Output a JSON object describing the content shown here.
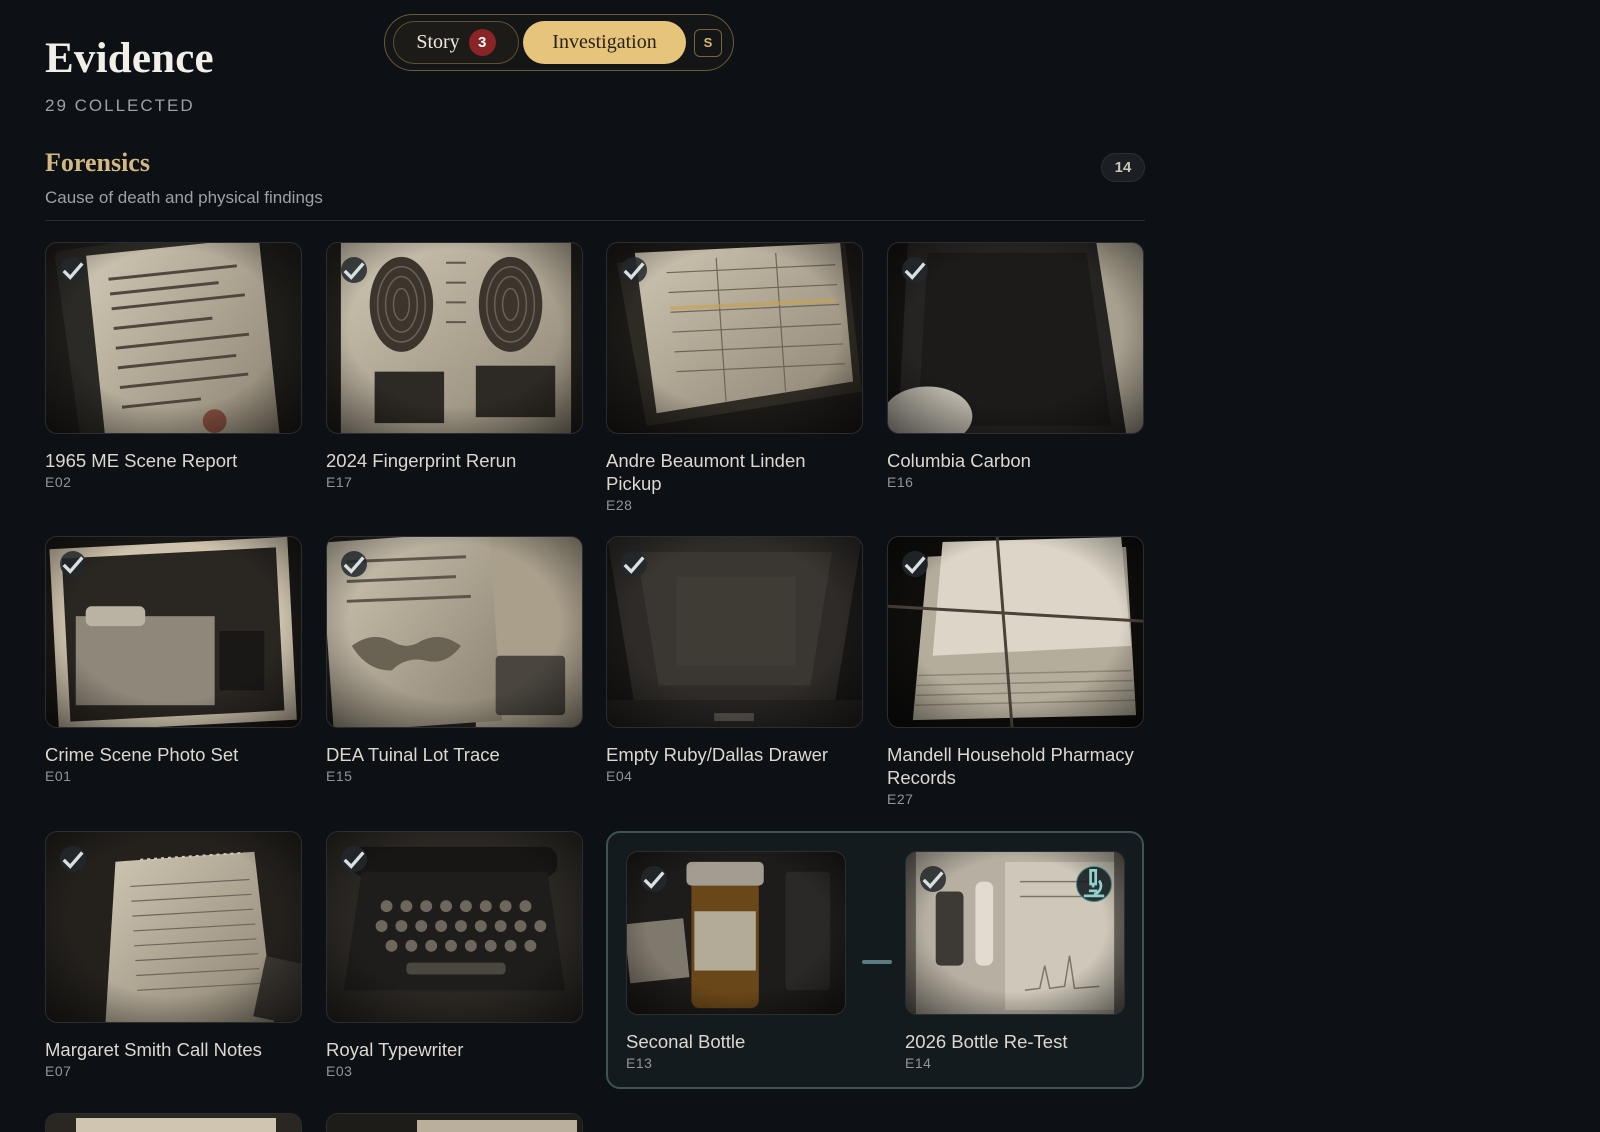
{
  "header": {
    "title": "Evidence",
    "subtitle": "29 COLLECTED"
  },
  "mode_switch": {
    "story_label": "Story",
    "story_badge": "3",
    "investigation_label": "Investigation",
    "shortcut_key": "S",
    "active": "Investigation"
  },
  "section": {
    "title": "Forensics",
    "description": "Cause of death and physical findings",
    "count": "14"
  },
  "cards": [
    {
      "title": "1965 ME Scene Report",
      "code": "E02",
      "collected": true,
      "icon": "report-image"
    },
    {
      "title": "2024 Fingerprint Rerun",
      "code": "E17",
      "collected": true,
      "icon": "fingerprint-image"
    },
    {
      "title": "Andre Beaumont Linden Pickup",
      "code": "E28",
      "collected": true,
      "icon": "ledger-image"
    },
    {
      "title": "Columbia Carbon",
      "code": "E16",
      "collected": true,
      "icon": "carbon-paper-image"
    },
    {
      "title": "Crime Scene Photo Set",
      "code": "E01",
      "collected": true,
      "icon": "bedroom-photo-image"
    },
    {
      "title": "DEA Tuinal Lot Trace",
      "code": "E15",
      "collected": true,
      "icon": "map-document-image"
    },
    {
      "title": "Empty Ruby/Dallas Drawer",
      "code": "E04",
      "collected": true,
      "icon": "drawer-image"
    },
    {
      "title": "Mandell Household Pharmacy Records",
      "code": "E27",
      "collected": true,
      "icon": "paper-bundle-image"
    },
    {
      "title": "Margaret Smith Call Notes",
      "code": "E07",
      "collected": true,
      "icon": "notepad-image"
    },
    {
      "title": "Royal Typewriter",
      "code": "E03",
      "collected": true,
      "icon": "typewriter-image"
    }
  ],
  "linked_pair": [
    {
      "title": "Seconal Bottle",
      "code": "E13",
      "collected": true,
      "icon": "pill-bottle-image"
    },
    {
      "title": "2026 Bottle Re-Test",
      "code": "E14",
      "collected": true,
      "icon": "evidence-bag-image",
      "action_icon": "microscope-icon"
    }
  ],
  "colors": {
    "background": "#0d1014",
    "accent_gold": "#e6c47c",
    "section_title": "#d3b884",
    "badge_red": "#8a2426",
    "linked_border": "#3c5357"
  }
}
